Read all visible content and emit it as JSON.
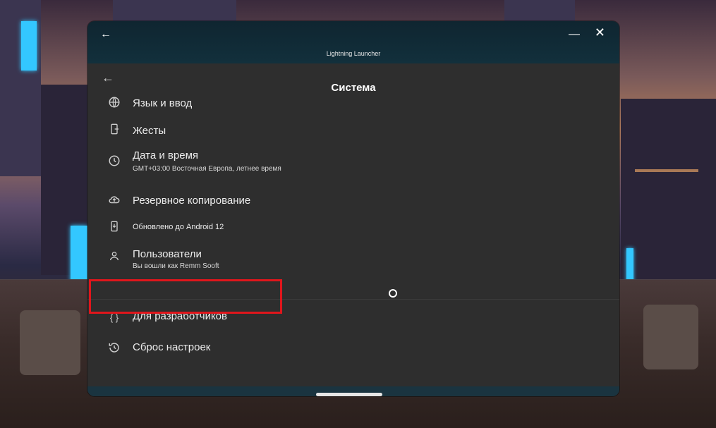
{
  "window": {
    "app_title": "Lightning Launcher",
    "back_icon": "←",
    "minimize_icon": "—",
    "close_icon": "✕"
  },
  "page": {
    "back_icon": "←",
    "title": "Система"
  },
  "settings": {
    "language": {
      "icon": "globe-icon",
      "label": "Язык и ввод"
    },
    "gestures": {
      "icon": "phone-gesture-icon",
      "label": "Жесты"
    },
    "datetime": {
      "icon": "clock-icon",
      "label": "Дата и время",
      "sub": "GMT+03:00 Восточная Европа, летнее время"
    },
    "backup": {
      "icon": "cloud-upload-icon",
      "label": "Резервное копирование"
    },
    "update": {
      "icon": "system-update-icon",
      "label": "Обновлено до Android 12"
    },
    "users": {
      "icon": "person-icon",
      "label": "Пользователи",
      "sub": "Вы вошли как Remm Sooft"
    },
    "developer": {
      "icon": "braces-icon",
      "icon_text": "{ }",
      "label": "Для разработчиков"
    },
    "reset": {
      "icon": "history-icon",
      "label": "Сброс настроек"
    }
  },
  "colors": {
    "highlight": "#e0161c",
    "window_bg": "#2d2d2d",
    "title_bar": "#12303c"
  }
}
